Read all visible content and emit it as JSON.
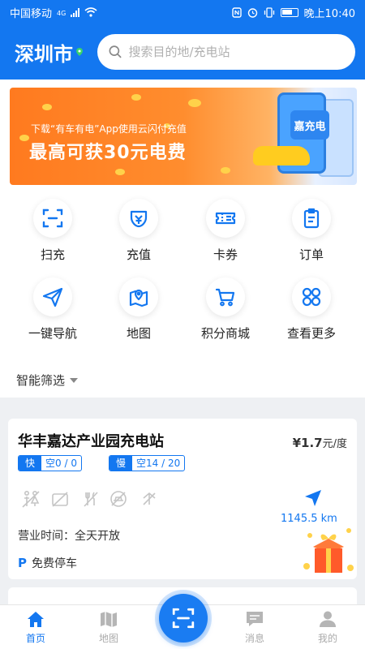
{
  "status_bar": {
    "carrier": "中国移动",
    "network": "4G",
    "time": "晚上10:40"
  },
  "header": {
    "city": "深圳市",
    "search_placeholder": "搜索目的地/充电站"
  },
  "banner": {
    "line1": "下载“有车有电”App使用云闪付充值",
    "line2": "最高可获30元电费",
    "badge": "嘉充电"
  },
  "quick_actions": [
    {
      "label": "扫充",
      "icon": "scan-icon"
    },
    {
      "label": "充值",
      "icon": "wallet-icon"
    },
    {
      "label": "卡券",
      "icon": "coupon-icon"
    },
    {
      "label": "订单",
      "icon": "clipboard-icon"
    },
    {
      "label": "一键导航",
      "icon": "paper-plane-icon"
    },
    {
      "label": "地图",
      "icon": "map-icon"
    },
    {
      "label": "积分商城",
      "icon": "cart-icon"
    },
    {
      "label": "查看更多",
      "icon": "grid-icon"
    }
  ],
  "filter": {
    "label": "智能筛选"
  },
  "station": {
    "name": "华丰嘉达产业园充电站",
    "price_value": "¥1.7",
    "price_unit": "元/度",
    "fast_label": "快",
    "fast_free": "空0 / 0",
    "slow_label": "慢",
    "slow_free": "空14 / 20",
    "distance": "1145.5 km",
    "hours": "营业时间：全天开放",
    "parking": "免费停车"
  },
  "tabbar": {
    "tabs": [
      {
        "label": "首页"
      },
      {
        "label": "地图"
      },
      {
        "label": "消息"
      },
      {
        "label": "我的"
      }
    ]
  },
  "colors": {
    "primary": "#1377f0",
    "banner_orange": "#ff7a1f",
    "background": "#eef0f3"
  }
}
